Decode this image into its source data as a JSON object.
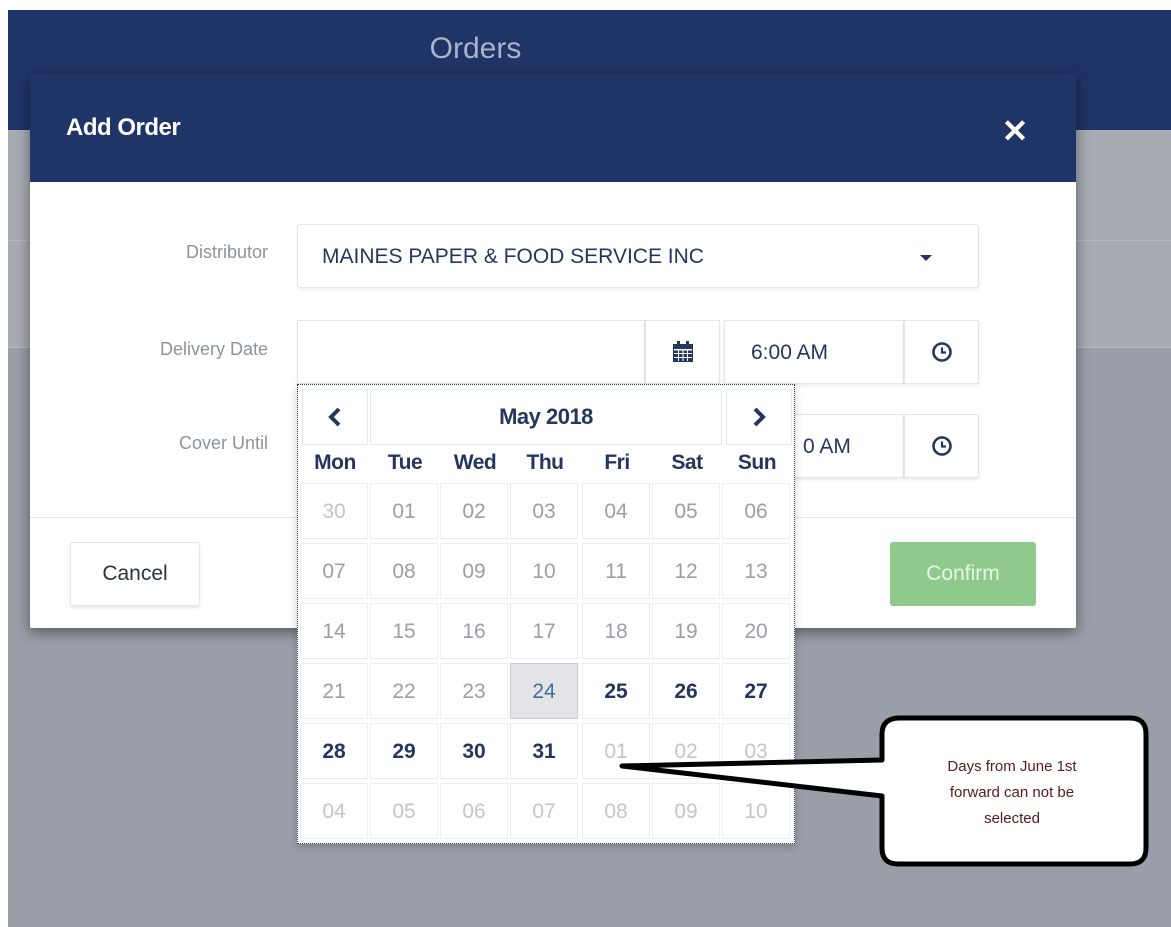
{
  "app": {
    "title": "Orders"
  },
  "modal": {
    "title": "Add Order",
    "close_icon": "close-icon",
    "fields": {
      "distributor_label": "Distributor",
      "distributor_value": "MAINES PAPER & FOOD SERVICE INC",
      "delivery_date_label": "Delivery Date",
      "delivery_date_value": "",
      "delivery_time_value": "6:00 AM",
      "cover_until_label": "Cover Until",
      "cover_until_time_value": "0 AM"
    },
    "buttons": {
      "cancel": "Cancel",
      "confirm": "Confirm"
    }
  },
  "datepicker": {
    "prev_icon": "chevron-left-icon",
    "next_icon": "chevron-right-icon",
    "month_label": "May 2018",
    "weekdays": [
      "Mon",
      "Tue",
      "Wed",
      "Thu",
      "Fri",
      "Sat",
      "Sun"
    ],
    "weeks": [
      [
        {
          "d": "30",
          "s": "muted"
        },
        {
          "d": "01",
          "s": "disabled"
        },
        {
          "d": "02",
          "s": "disabled"
        },
        {
          "d": "03",
          "s": "disabled"
        },
        {
          "d": "04",
          "s": "disabled"
        },
        {
          "d": "05",
          "s": "disabled"
        },
        {
          "d": "06",
          "s": "disabled"
        }
      ],
      [
        {
          "d": "07",
          "s": "disabled"
        },
        {
          "d": "08",
          "s": "disabled"
        },
        {
          "d": "09",
          "s": "disabled"
        },
        {
          "d": "10",
          "s": "disabled"
        },
        {
          "d": "11",
          "s": "disabled"
        },
        {
          "d": "12",
          "s": "disabled"
        },
        {
          "d": "13",
          "s": "disabled"
        }
      ],
      [
        {
          "d": "14",
          "s": "disabled"
        },
        {
          "d": "15",
          "s": "disabled"
        },
        {
          "d": "16",
          "s": "disabled"
        },
        {
          "d": "17",
          "s": "disabled"
        },
        {
          "d": "18",
          "s": "disabled"
        },
        {
          "d": "19",
          "s": "disabled"
        },
        {
          "d": "20",
          "s": "disabled"
        }
      ],
      [
        {
          "d": "21",
          "s": "disabled"
        },
        {
          "d": "22",
          "s": "disabled"
        },
        {
          "d": "23",
          "s": "disabled"
        },
        {
          "d": "24",
          "s": "today"
        },
        {
          "d": "25",
          "s": "enabled"
        },
        {
          "d": "26",
          "s": "enabled"
        },
        {
          "d": "27",
          "s": "enabled"
        }
      ],
      [
        {
          "d": "28",
          "s": "enabled"
        },
        {
          "d": "29",
          "s": "enabled"
        },
        {
          "d": "30",
          "s": "enabled"
        },
        {
          "d": "31",
          "s": "enabled"
        },
        {
          "d": "01",
          "s": "muted"
        },
        {
          "d": "02",
          "s": "muted"
        },
        {
          "d": "03",
          "s": "muted"
        }
      ],
      [
        {
          "d": "04",
          "s": "muted"
        },
        {
          "d": "05",
          "s": "muted"
        },
        {
          "d": "06",
          "s": "muted"
        },
        {
          "d": "07",
          "s": "muted"
        },
        {
          "d": "08",
          "s": "muted"
        },
        {
          "d": "09",
          "s": "muted"
        },
        {
          "d": "10",
          "s": "muted"
        }
      ]
    ]
  },
  "callout": {
    "lines": [
      "Days from June 1st",
      "forward can not be",
      "selected"
    ]
  },
  "colors": {
    "header": "#1f3467",
    "text_primary": "#24365f",
    "confirm_bg": "#8fca8c",
    "overlay": "#9a9ea8"
  }
}
